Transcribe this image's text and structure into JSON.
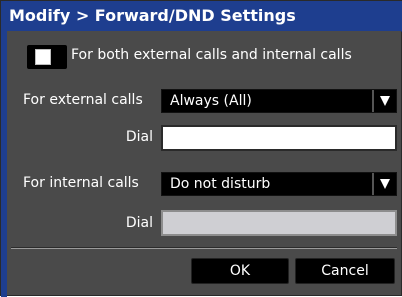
{
  "dialog": {
    "title": "Modify > Forward/DND Settings"
  },
  "checkbox": {
    "label": "For both external calls and internal calls",
    "checked": false
  },
  "external": {
    "label": "For external calls",
    "selected": "Always (All)",
    "dial_label": "Dial",
    "dial_value": ""
  },
  "internal": {
    "label": "For internal calls",
    "selected": "Do not disturb",
    "dial_label": "Dial",
    "dial_value": ""
  },
  "buttons": {
    "ok": "OK",
    "cancel": "Cancel"
  }
}
